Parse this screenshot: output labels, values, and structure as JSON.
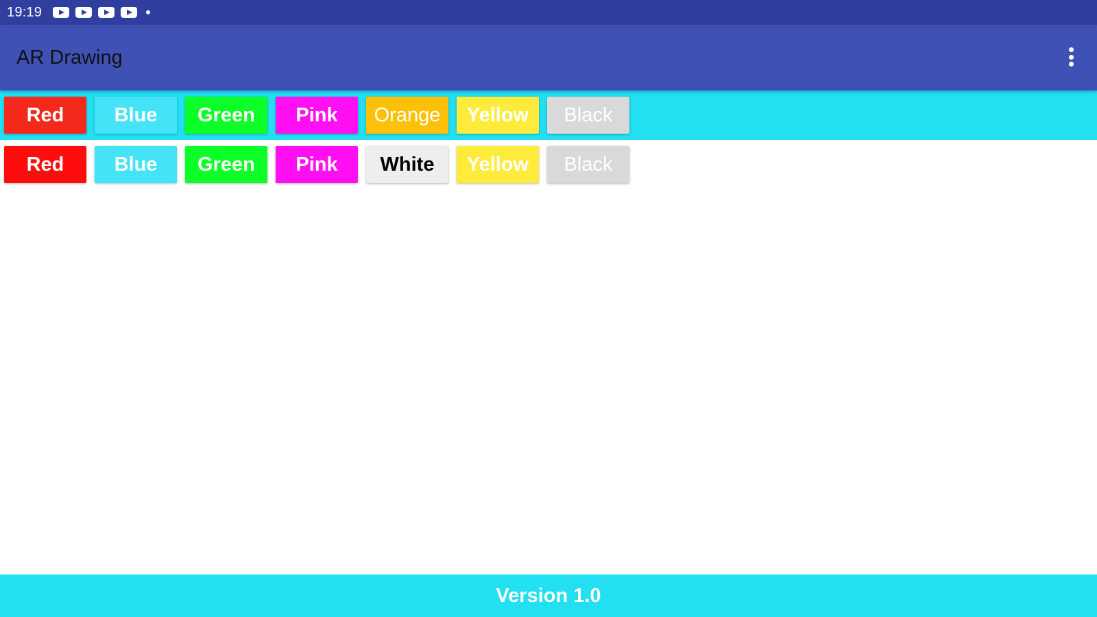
{
  "status_bar": {
    "time": "19:19",
    "notification_icons": [
      "youtube-icon",
      "youtube-icon",
      "youtube-icon",
      "youtube-icon",
      "dot-icon"
    ],
    "background": "#303f9f"
  },
  "app_bar": {
    "title": "AR Drawing",
    "menu_icon": "more-vert-icon",
    "background": "#3f51b5"
  },
  "brush_colors": {
    "background": "#22dff2",
    "buttons": [
      {
        "label": "Red",
        "bg": "#f5281c",
        "text": "#ffffff"
      },
      {
        "label": "Blue",
        "bg": "#44e3f7",
        "text": "#ffffff"
      },
      {
        "label": "Green",
        "bg": "#0cff27",
        "text": "#ffffff"
      },
      {
        "label": "Pink",
        "bg": "#ff0ff2",
        "text": "#ffffff"
      },
      {
        "label": "Orange",
        "bg": "#ffc107",
        "text": "#ffffff"
      },
      {
        "label": "Yellow",
        "bg": "#ffeb3b",
        "text": "#ffffff"
      },
      {
        "label": "Black",
        "bg": "#d9d9d9",
        "text": "#ffffff"
      }
    ]
  },
  "background_colors": {
    "background": "#ffffff",
    "buttons": [
      {
        "label": "Red",
        "bg": "#ff0d0d",
        "text": "#ffffff"
      },
      {
        "label": "Blue",
        "bg": "#44e3f7",
        "text": "#ffffff"
      },
      {
        "label": "Green",
        "bg": "#0cff27",
        "text": "#ffffff"
      },
      {
        "label": "Pink",
        "bg": "#ff0ff2",
        "text": "#ffffff"
      },
      {
        "label": "White",
        "bg": "#eeeeee",
        "text": "#000000"
      },
      {
        "label": "Yellow",
        "bg": "#ffeb3b",
        "text": "#ffffff"
      },
      {
        "label": "Black",
        "bg": "#d9d9d9",
        "text": "#ffffff"
      }
    ]
  },
  "footer": {
    "version_text": "Version 1.0",
    "background": "#22dff2"
  }
}
